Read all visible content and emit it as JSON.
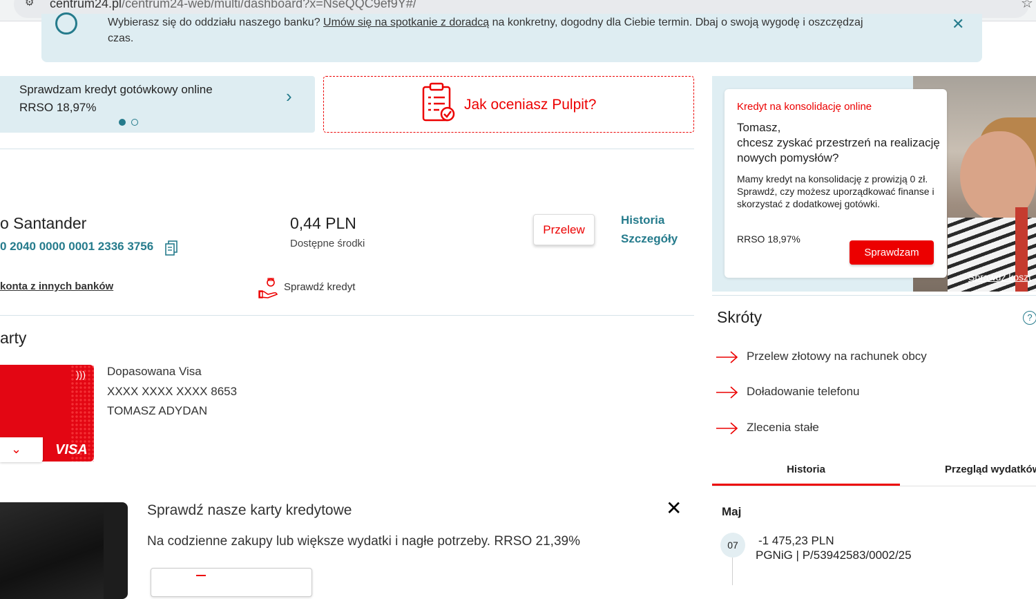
{
  "browser": {
    "url_host": "centrum24.pl",
    "url_path": "/centrum24-web/multi/dashboard?x=NseQQC9ef9Y#/"
  },
  "info_banner": {
    "line1_prefix": "Wybierasz się do oddziału naszego banku? ",
    "line1_link": "Umów się na spotkanie z doradcą",
    "line1_suffix": " na konkretny, dogodny dla Ciebie termin. Dbaj o swoją wygodę i oszczędzaj",
    "line2": "czas."
  },
  "promo": {
    "title": "Sprawdzam kredyt gotówkowy online",
    "rrso": "RRSO 18,97%"
  },
  "rating": {
    "label": "Jak oceniasz Pulpit?"
  },
  "account": {
    "name": "o Santander",
    "number": "0 2040 0000 0001 2336 3756",
    "balance": "0,44 PLN",
    "balance_label": "Dostępne środki",
    "transfer_button": "Przelew",
    "history_link": "Historia",
    "details_link": "Szczegóły",
    "other_banks_link": "konta z innych banków",
    "check_credit": "Sprawdź kredyt"
  },
  "cards": {
    "heading": "arty",
    "card_name": "Dopasowana Visa",
    "card_number": "XXXX XXXX XXXX 8653",
    "holder": "TOMASZ ADYDAN",
    "brand": "VISA"
  },
  "credit_promo": {
    "title": "Sprawdź nasze karty kredytowe",
    "description": "Na codzienne zakupy lub większe wydatki i nagłe potrzeby. RRSO 21,39%"
  },
  "ad": {
    "tag": "Kredyt na konsolidację online",
    "heading": "Tomasz,\nchcesz zyskać przestrzeń na realizację nowych pomysłów?",
    "body": "Mamy kredyt na konsolidację z prowizją 0 zł. Sprawdź, czy możesz uporządkować finanse i skorzystać z dodatkowej gotówki.",
    "rrso": "RRSO 18,97%",
    "button": "Sprawdzam",
    "photo_link": "Sprawdź koszt"
  },
  "shortcuts": {
    "heading": "Skróty",
    "items": [
      "Przelew złotowy na rachunek obcy",
      "Doładowanie telefonu",
      "Zlecenia stałe"
    ]
  },
  "history_tabs": {
    "active": "Historia",
    "other": "Przegląd wydatków"
  },
  "history": {
    "month": "Maj",
    "transactions": [
      {
        "day": "07",
        "amount": "-1 475,23 PLN",
        "description": "PGNiG | P/53942583/0002/25"
      }
    ]
  },
  "colors": {
    "brand_red": "#ec0000",
    "teal": "#257b8c",
    "light_blue": "#deedf2"
  }
}
